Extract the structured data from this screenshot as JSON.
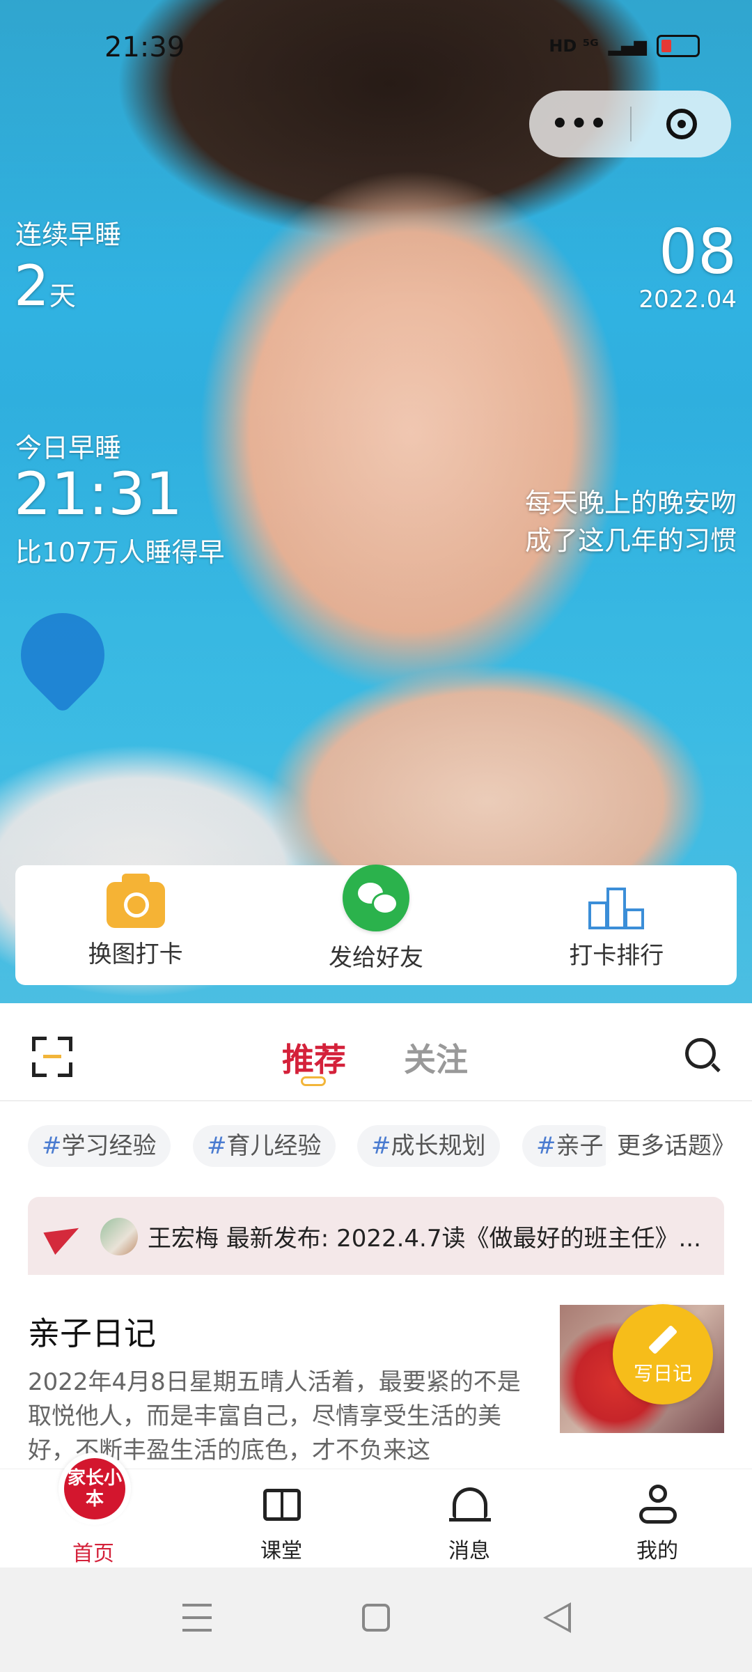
{
  "status_bar": {
    "time": "21:39",
    "network": "HD ⁵ᴳ"
  },
  "capsule": {
    "more_label": "•••"
  },
  "streak": {
    "label": "连续早睡",
    "number": "2",
    "unit": "天"
  },
  "today": {
    "label": "今日早睡",
    "time": "21:31",
    "compare": "比107万人睡得早"
  },
  "date": {
    "day": "08",
    "year_month": "2022.04"
  },
  "quote": {
    "line1": "每天晚上的晚安吻",
    "line2": "成了这几年的习惯"
  },
  "actions": [
    {
      "label": "换图打卡",
      "icon": "camera-icon"
    },
    {
      "label": "发给好友",
      "icon": "wechat-icon"
    },
    {
      "label": "打卡排行",
      "icon": "podium-icon"
    }
  ],
  "tabs": {
    "recommend": "推荐",
    "follow": "关注"
  },
  "topics": [
    {
      "hash": "#",
      "name": "学习经验"
    },
    {
      "hash": "#",
      "name": "育儿经验"
    },
    {
      "hash": "#",
      "name": "成长规划"
    },
    {
      "hash": "#",
      "name": "亲子"
    }
  ],
  "more_topics": "更多话题》",
  "news": {
    "text": "王宏梅 最新发布: 2022.4.7读《做最好的班主任》..."
  },
  "diary": {
    "title": "亲子日记",
    "body": "2022年4月8日星期五晴人活着，最要紧的不是取悦他人，而是丰富自己，尽情享受生活的美好，不断丰盈生活的底色，才不负来这",
    "write_label": "写日记"
  },
  "bottom_nav": {
    "home_logo": "家长小本",
    "home": "首页",
    "classroom": "课堂",
    "messages": "消息",
    "me": "我的"
  },
  "colors": {
    "accent": "#d4213a",
    "write": "#f6bd1a",
    "wechat": "#2bb24c",
    "camera": "#f5b335",
    "rank": "#3b8ed8"
  }
}
